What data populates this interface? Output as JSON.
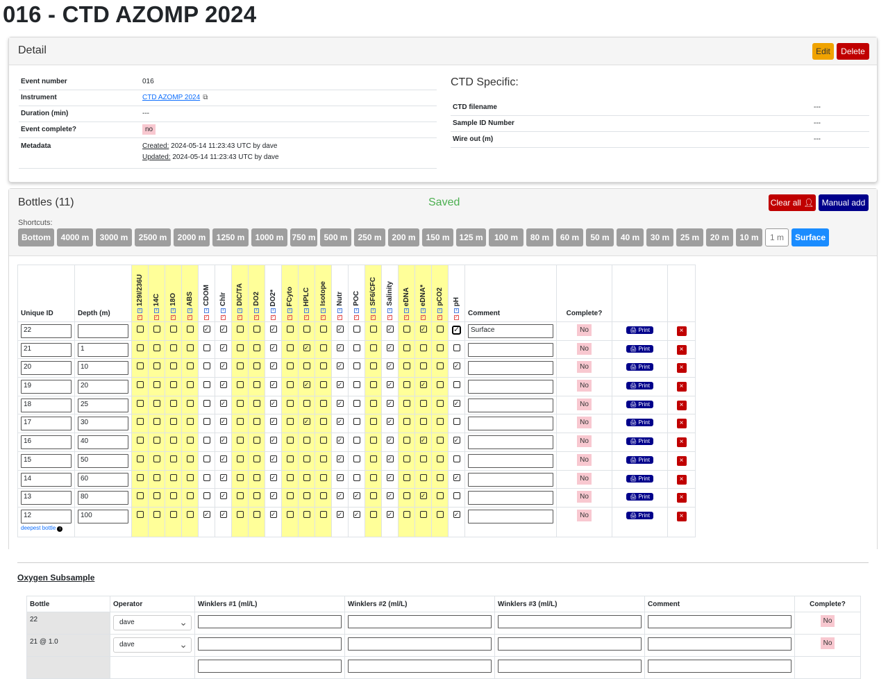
{
  "page": {
    "title": "016 - CTD AZOMP 2024"
  },
  "detail": {
    "title": "Detail",
    "edit_label": "Edit",
    "delete_label": "Delete",
    "fields": {
      "event_number_label": "Event number",
      "event_number": "016",
      "instrument_label": "Instrument",
      "instrument": "CTD AZOMP 2024",
      "duration_label": "Duration (min)",
      "duration": "---",
      "complete_label": "Event complete?",
      "complete": "no",
      "metadata_label": "Metadata",
      "created_label": "Created:",
      "created": " 2024-05-14 11:23:43 UTC by dave",
      "updated_label": "Updated:",
      "updated": " 2024-05-14 11:23:43 UTC by dave"
    },
    "ctd": {
      "title": "CTD Specific:",
      "filename_label": "CTD filename",
      "filename": "---",
      "sample_id_label": "Sample ID Number",
      "sample_id": "---",
      "wire_out_label": "Wire out (m)",
      "wire_out": "---"
    }
  },
  "bottles": {
    "title": "Bottles (11)",
    "saved": "Saved",
    "clear_all_label": "Clear all",
    "manual_add_label": "Manual add",
    "shortcuts_label": "Shortcuts:",
    "shortcuts": [
      "Bottom",
      "4000 m",
      "3000 m",
      "2500 m",
      "2000 m",
      "1250 m",
      "1000 m",
      "750 m",
      "500 m",
      "250 m",
      "200 m",
      "150 m",
      "125 m",
      "100 m",
      "80 m",
      "60 m",
      "50 m",
      "40 m",
      "30 m",
      "25 m",
      "20 m",
      "10 m",
      "1 m",
      "Surface"
    ],
    "col_unique_id": "Unique ID",
    "col_depth": "Depth (m)",
    "col_comment": "Comment",
    "col_complete": "Complete?",
    "sample_types": [
      "129I/236U",
      "14C",
      "18O",
      "ABS",
      "CDOM",
      "Chlr",
      "DIC/TA",
      "DO2",
      "DO2*",
      "FCyto",
      "HPLC",
      "Isotope",
      "Nutr",
      "POC",
      "SF6/CFC",
      "Salinity",
      "eDNA",
      "eDNA*",
      "pCO2",
      "pH"
    ],
    "yellow_columns": [
      true,
      true,
      true,
      true,
      false,
      false,
      true,
      true,
      false,
      true,
      true,
      true,
      false,
      false,
      true,
      false,
      true,
      true,
      true,
      false
    ],
    "rows": [
      {
        "id": "22",
        "depth": "",
        "comment": "Surface",
        "complete": "No",
        "checks": [
          0,
          0,
          0,
          0,
          1,
          1,
          0,
          0,
          1,
          0,
          0,
          0,
          1,
          0,
          0,
          1,
          0,
          1,
          0,
          1
        ]
      },
      {
        "id": "21",
        "depth": "1",
        "comment": "",
        "complete": "No",
        "checks": [
          0,
          0,
          0,
          0,
          0,
          1,
          0,
          0,
          1,
          0,
          1,
          0,
          1,
          0,
          0,
          1,
          0,
          0,
          0,
          0
        ]
      },
      {
        "id": "20",
        "depth": "10",
        "comment": "",
        "complete": "No",
        "checks": [
          0,
          0,
          0,
          0,
          0,
          1,
          0,
          0,
          1,
          0,
          0,
          0,
          1,
          0,
          0,
          1,
          0,
          0,
          0,
          1
        ]
      },
      {
        "id": "19",
        "depth": "20",
        "comment": "",
        "complete": "No",
        "checks": [
          0,
          0,
          0,
          0,
          0,
          1,
          0,
          0,
          1,
          0,
          1,
          0,
          1,
          0,
          0,
          1,
          0,
          1,
          0,
          0
        ]
      },
      {
        "id": "18",
        "depth": "25",
        "comment": "",
        "complete": "No",
        "checks": [
          0,
          0,
          0,
          0,
          0,
          1,
          0,
          0,
          1,
          0,
          0,
          0,
          1,
          0,
          0,
          1,
          0,
          0,
          0,
          1
        ]
      },
      {
        "id": "17",
        "depth": "30",
        "comment": "",
        "complete": "No",
        "checks": [
          0,
          0,
          0,
          0,
          0,
          1,
          0,
          0,
          1,
          0,
          1,
          0,
          1,
          0,
          0,
          1,
          0,
          0,
          0,
          0
        ]
      },
      {
        "id": "16",
        "depth": "40",
        "comment": "",
        "complete": "No",
        "checks": [
          0,
          0,
          0,
          0,
          0,
          1,
          0,
          0,
          1,
          0,
          0,
          0,
          1,
          0,
          0,
          1,
          0,
          1,
          0,
          1
        ]
      },
      {
        "id": "15",
        "depth": "50",
        "comment": "",
        "complete": "No",
        "checks": [
          0,
          0,
          0,
          0,
          0,
          1,
          0,
          0,
          1,
          0,
          0,
          0,
          1,
          0,
          0,
          1,
          0,
          0,
          0,
          0
        ]
      },
      {
        "id": "14",
        "depth": "60",
        "comment": "",
        "complete": "No",
        "checks": [
          0,
          0,
          0,
          0,
          0,
          1,
          0,
          0,
          1,
          0,
          0,
          0,
          1,
          0,
          0,
          1,
          0,
          0,
          0,
          1
        ]
      },
      {
        "id": "13",
        "depth": "80",
        "comment": "",
        "complete": "No",
        "checks": [
          0,
          0,
          0,
          0,
          0,
          1,
          0,
          0,
          1,
          0,
          0,
          0,
          1,
          1,
          0,
          1,
          0,
          1,
          0,
          0
        ]
      },
      {
        "id": "12",
        "depth": "100",
        "comment": "",
        "complete": "No",
        "checks": [
          0,
          0,
          0,
          0,
          1,
          1,
          0,
          0,
          1,
          0,
          0,
          0,
          1,
          1,
          0,
          1,
          0,
          0,
          0,
          1
        ]
      }
    ],
    "print_label": "Print",
    "delete_glyph": "×",
    "deepest_label": "deepest bottle",
    "deepest_info_glyph": "i"
  },
  "oxygen": {
    "title": "Oxygen Subsample",
    "headers": [
      "Bottle",
      "Operator",
      "Winklers #1 (ml/L)",
      "Winklers #2 (ml/L)",
      "Winklers #3 (ml/L)",
      "Comment",
      "Complete?"
    ],
    "rows": [
      {
        "bottle": "22",
        "operator": "dave",
        "complete": "No"
      },
      {
        "bottle": "21 @ 1.0",
        "operator": "dave",
        "complete": "No"
      }
    ]
  },
  "colors": {
    "yellow": "#ffff99",
    "red": "#c00000",
    "navy": "#00008b",
    "amber": "#f0a300",
    "blue": "#1a8cff",
    "saved_green": "#4caf50",
    "no_badge": "#f8c8d0"
  },
  "icons": {
    "external_link": "external-link-icon",
    "user": "user-icon",
    "print": "printer-icon",
    "close": "close-icon",
    "info": "info-icon",
    "chevron": "chevron-down-icon",
    "check": "check-icon"
  }
}
